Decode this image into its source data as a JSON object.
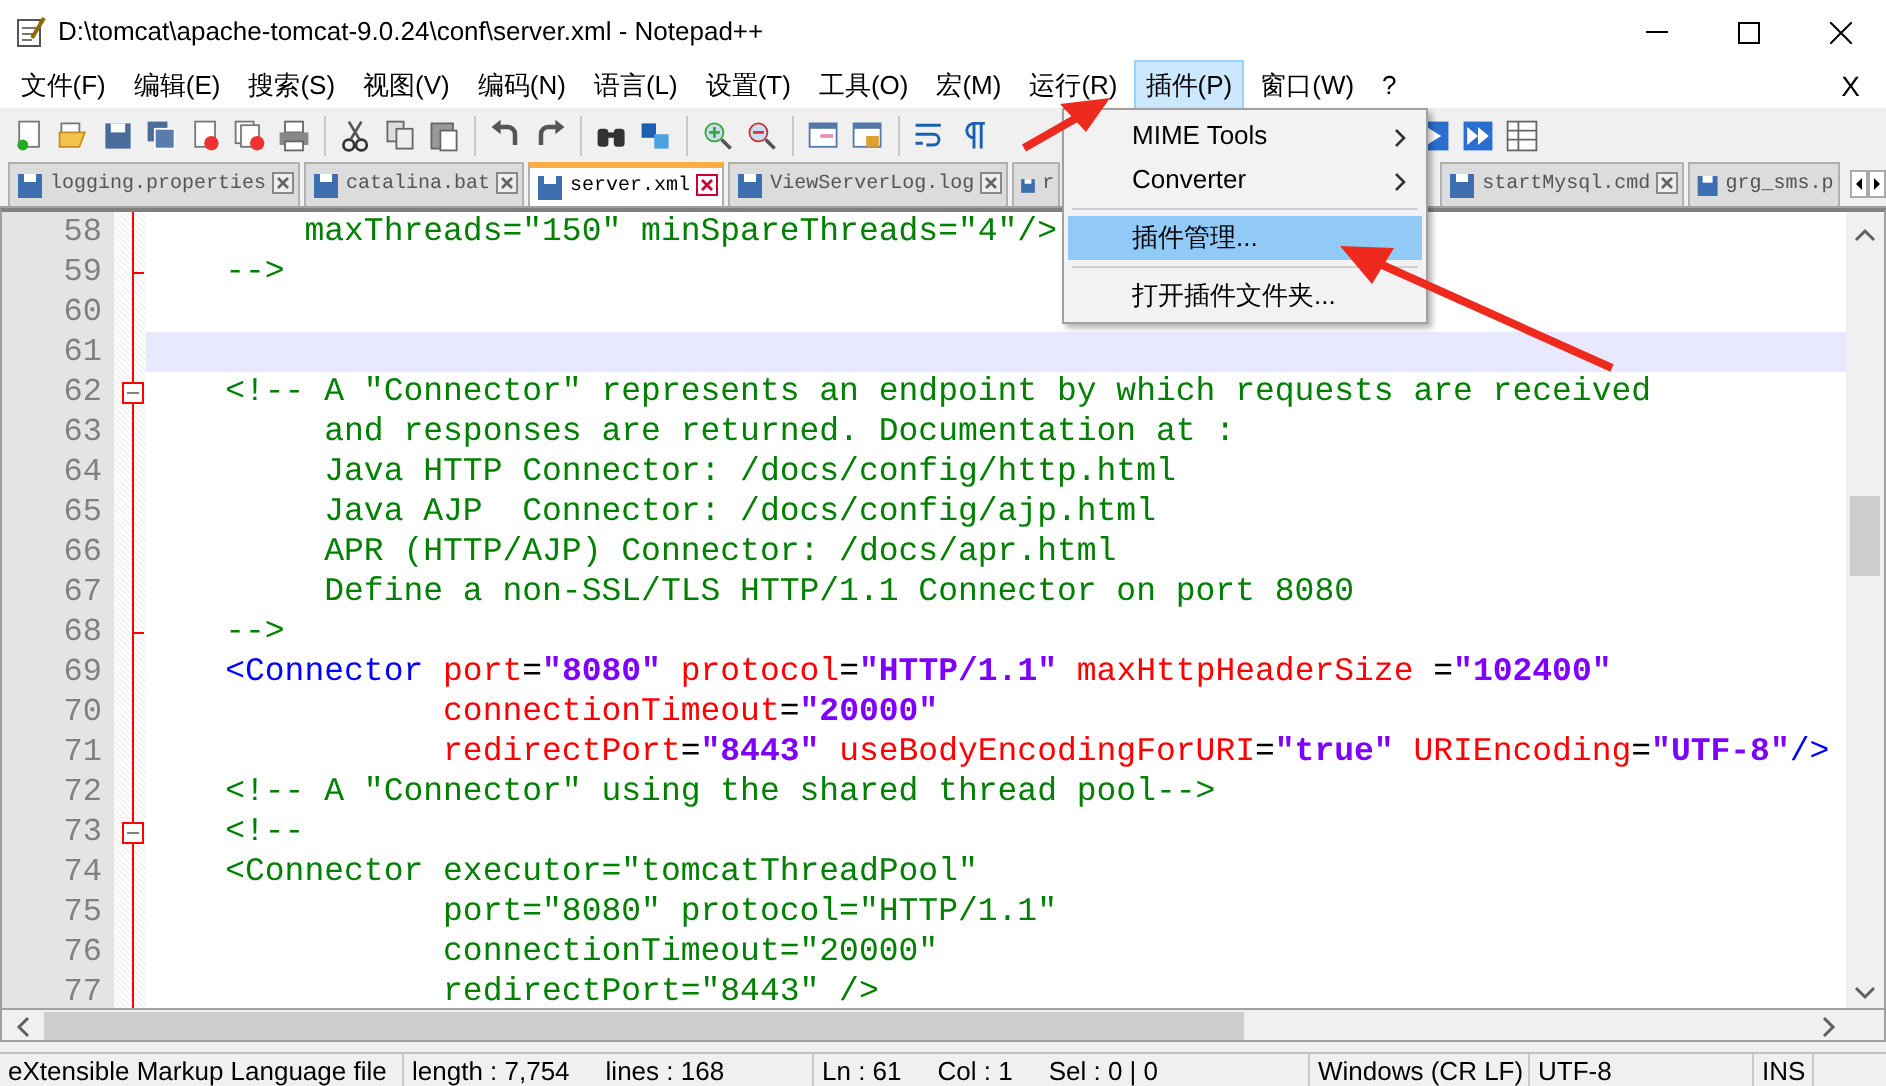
{
  "window": {
    "title": "D:\\tomcat\\apache-tomcat-9.0.24\\conf\\server.xml - Notepad++"
  },
  "menu_bar": [
    {
      "label": "文件(F)",
      "selected": false
    },
    {
      "label": "编辑(E)",
      "selected": false
    },
    {
      "label": "搜索(S)",
      "selected": false
    },
    {
      "label": "视图(V)",
      "selected": false
    },
    {
      "label": "编码(N)",
      "selected": false
    },
    {
      "label": "语言(L)",
      "selected": false
    },
    {
      "label": "设置(T)",
      "selected": false
    },
    {
      "label": "工具(O)",
      "selected": false
    },
    {
      "label": "宏(M)",
      "selected": false
    },
    {
      "label": "运行(R)",
      "selected": false
    },
    {
      "label": "插件(P)",
      "selected": true
    },
    {
      "label": "窗口(W)",
      "selected": false
    },
    {
      "label": "?",
      "selected": false
    }
  ],
  "close_document": "X",
  "tabs": [
    {
      "label": "logging.properties",
      "selected": false
    },
    {
      "label": "catalina.bat",
      "selected": false
    },
    {
      "label": "server.xml",
      "selected": true
    },
    {
      "label": "ViewServerLog.log",
      "selected": false
    },
    {
      "label": "r",
      "selected": false
    },
    {
      "label": "startMysql.cmd",
      "selected": false
    },
    {
      "label": "grg_sms.p",
      "selected": false
    }
  ],
  "plugin_menu": [
    {
      "label": "MIME Tools",
      "kind": "submenu",
      "selected": false
    },
    {
      "label": "Converter",
      "kind": "submenu",
      "selected": false
    },
    {
      "label": "插件管理...",
      "kind": "item",
      "selected": true
    },
    {
      "label": "打开插件文件夹...",
      "kind": "item",
      "selected": false
    }
  ],
  "editor": {
    "lines": [
      {
        "number": "58",
        "fold_box": false,
        "fold_end": false,
        "current": false,
        "segments": [
          {
            "kind": "comment",
            "text": "        maxThreads=\"150\" minSpareThreads=\"4\"/>"
          }
        ]
      },
      {
        "number": "59",
        "fold_box": false,
        "fold_end": true,
        "current": false,
        "segments": [
          {
            "kind": "comment",
            "text": "    -->"
          }
        ]
      },
      {
        "number": "60",
        "fold_box": false,
        "fold_end": false,
        "current": false
      },
      {
        "number": "61",
        "fold_box": false,
        "fold_end": false,
        "current": true
      },
      {
        "number": "62",
        "fold_box": true,
        "fold_end": false,
        "current": false,
        "segments": [
          {
            "kind": "comment",
            "text": "    <!-- A \"Connector\" represents an endpoint by which requests are received"
          }
        ]
      },
      {
        "number": "63",
        "fold_box": false,
        "fold_end": false,
        "current": false,
        "segments": [
          {
            "kind": "comment",
            "text": "         and responses are returned. Documentation at :"
          }
        ]
      },
      {
        "number": "64",
        "fold_box": false,
        "fold_end": false,
        "current": false,
        "segments": [
          {
            "kind": "comment",
            "text": "         Java HTTP Connector: /docs/config/http.html"
          }
        ]
      },
      {
        "number": "65",
        "fold_box": false,
        "fold_end": false,
        "current": false,
        "segments": [
          {
            "kind": "comment",
            "text": "         Java AJP  Connector: /docs/config/ajp.html"
          }
        ]
      },
      {
        "number": "66",
        "fold_box": false,
        "fold_end": false,
        "current": false,
        "segments": [
          {
            "kind": "comment",
            "text": "         APR (HTTP/AJP) Connector: /docs/apr.html"
          }
        ]
      },
      {
        "number": "67",
        "fold_box": false,
        "fold_end": false,
        "current": false,
        "segments": [
          {
            "kind": "comment",
            "text": "         Define a non-SSL/TLS HTTP/1.1 Connector on port 8080"
          }
        ]
      },
      {
        "number": "68",
        "fold_box": false,
        "fold_end": true,
        "current": false,
        "segments": [
          {
            "kind": "comment",
            "text": "    -->"
          }
        ]
      },
      {
        "number": "69",
        "fold_box": false,
        "fold_end": false,
        "current": false,
        "segments": [
          {
            "kind": "tag",
            "text": "    <Connector "
          },
          {
            "kind": "attr",
            "text": "port"
          },
          {
            "kind": "text",
            "text": "="
          },
          {
            "kind": "value",
            "text": "\"8080\" "
          },
          {
            "kind": "attr",
            "text": "protocol"
          },
          {
            "kind": "text",
            "text": "="
          },
          {
            "kind": "value",
            "text": "\"HTTP/1.1\" "
          },
          {
            "kind": "attr",
            "text": "maxHttpHeaderSize"
          },
          {
            "kind": "text",
            "text": " ="
          },
          {
            "kind": "value",
            "text": "\"102400\""
          }
        ]
      },
      {
        "number": "70",
        "fold_box": false,
        "fold_end": false,
        "current": false,
        "segments": [
          {
            "kind": "attr",
            "text": "               connectionTimeout"
          },
          {
            "kind": "text",
            "text": "="
          },
          {
            "kind": "value",
            "text": "\"20000\""
          }
        ]
      },
      {
        "number": "71",
        "fold_box": false,
        "fold_end": false,
        "current": false,
        "segments": [
          {
            "kind": "attr",
            "text": "               redirectPort"
          },
          {
            "kind": "text",
            "text": "="
          },
          {
            "kind": "value",
            "text": "\"8443\" "
          },
          {
            "kind": "attr",
            "text": "useBodyEncodingForURI"
          },
          {
            "kind": "text",
            "text": "="
          },
          {
            "kind": "value",
            "text": "\"true\" "
          },
          {
            "kind": "attr",
            "text": "URIEncoding"
          },
          {
            "kind": "text",
            "text": "="
          },
          {
            "kind": "value",
            "text": "\"UTF-8\""
          },
          {
            "kind": "tag",
            "text": "/>"
          }
        ]
      },
      {
        "number": "72",
        "fold_box": false,
        "fold_end": false,
        "current": false,
        "segments": [
          {
            "kind": "comment",
            "text": "    <!-- A \"Connector\" using the shared thread pool-->"
          }
        ]
      },
      {
        "number": "73",
        "fold_box": true,
        "fold_end": false,
        "current": false,
        "segments": [
          {
            "kind": "comment",
            "text": "    <!--"
          }
        ]
      },
      {
        "number": "74",
        "fold_box": false,
        "fold_end": false,
        "current": false,
        "segments": [
          {
            "kind": "comment",
            "text": "    <Connector executor=\"tomcatThreadPool\""
          }
        ]
      },
      {
        "number": "75",
        "fold_box": false,
        "fold_end": false,
        "current": false,
        "segments": [
          {
            "kind": "comment",
            "text": "               port=\"8080\" protocol=\"HTTP/1.1\""
          }
        ]
      },
      {
        "number": "76",
        "fold_box": false,
        "fold_end": false,
        "current": false,
        "segments": [
          {
            "kind": "comment",
            "text": "               connectionTimeout=\"20000\""
          }
        ]
      },
      {
        "number": "77",
        "fold_box": false,
        "fold_end": false,
        "current": false,
        "segments": [
          {
            "kind": "comment",
            "text": "               redirectPort=\"8443\" />"
          }
        ]
      }
    ]
  },
  "status_bar": [
    "eXtensible Markup Language file",
    "length : 7,754",
    "lines : 168",
    "Ln : 61",
    "Col : 1",
    "Sel : 0 | 0",
    "Windows (CR LF)",
    "UTF-8",
    "INS"
  ]
}
